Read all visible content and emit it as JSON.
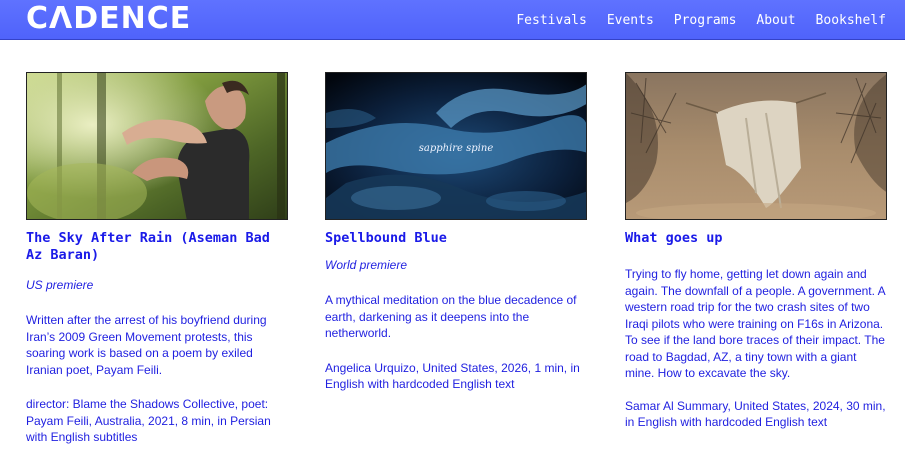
{
  "brand": {
    "logo": "CΛDENCE",
    "accent": "#4f63fb",
    "text_color": "#1f1fe0"
  },
  "nav": {
    "links": [
      "Festivals",
      "Events",
      "Programs",
      "About",
      "Bookshelf"
    ]
  },
  "films": [
    {
      "title": "The Sky After Rain (Aseman Bad Az Baran)",
      "premiere": "US premiere",
      "description": "Written after the arrest of his boyfriend during Iran’s 2009 Green Movement protests, this soaring work is based on a poem by exiled Iranian poet, Payam Feili.",
      "credits": "director: Blame the Shadows Collective, poet: Payam Feili, Australia, 2021, 8 min, in Persian with English subtitles"
    },
    {
      "title": "Spellbound Blue",
      "premiere": "World premiere",
      "thumb_caption": "sapphire spine",
      "description": "A mythical meditation on the blue decadence of earth, darkening as it deepens into the netherworld.",
      "credits": "Angelica Urquizo, United States, 2026, 1 min, in English with hardcoded English text"
    },
    {
      "title": "What goes up",
      "premiere": "",
      "description": "Trying to fly home, getting let down again and again. The downfall of a people. A government. A western road trip for the two crash sites of two Iraqi pilots who were training on F16s in Arizona. To see if the land bore traces of their impact. The road to Bagdad, AZ, a tiny town with a giant mine. How to excavate the sky.",
      "credits": "Samar Al Summary, United States, 2024, 30 min, in English with hardcoded English text"
    }
  ]
}
